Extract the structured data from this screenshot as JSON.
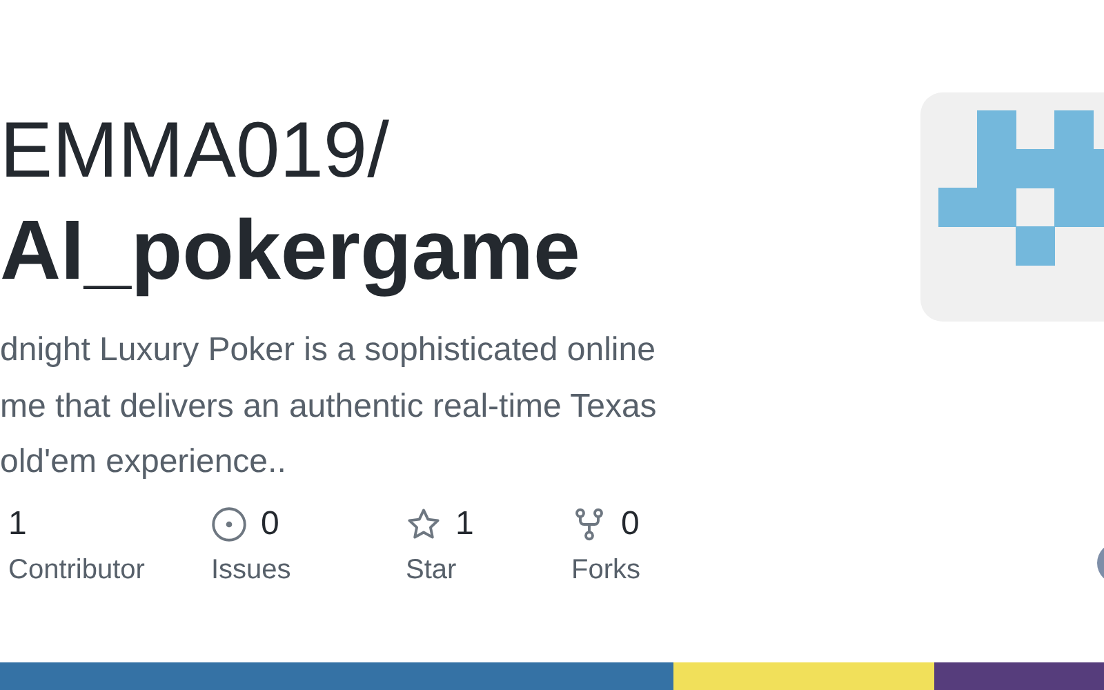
{
  "owner": "EMMA019/",
  "repo_name": "AI_pokergame",
  "description_lines": [
    "dnight Luxury Poker is a sophisticated online",
    "me that delivers an authentic real-time Texas",
    "old'em experience.."
  ],
  "stats": [
    {
      "kind": "contributors",
      "count": "1",
      "label": "Contributor"
    },
    {
      "kind": "issues",
      "count": "0",
      "label": "Issues"
    },
    {
      "kind": "stars",
      "count": "1",
      "label": "Star"
    },
    {
      "kind": "forks",
      "count": "0",
      "label": "Forks"
    }
  ],
  "languages": [
    {
      "color": "#3572a5"
    },
    {
      "color": "#f1e05a"
    },
    {
      "color": "#563d7c"
    }
  ]
}
